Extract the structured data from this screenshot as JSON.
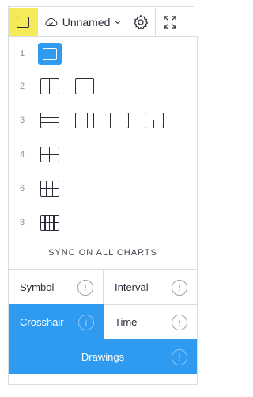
{
  "toolbar": {
    "layout_icon": "single-pane-layout-icon",
    "layout_accent": "#f5ea5a",
    "cloud_icon": "cloud-check-icon",
    "layout_name": "Unnamed",
    "chevron_icon": "chevron-down-icon",
    "settings_icon": "gear-icon",
    "fullscreen_icon": "fullscreen-icon"
  },
  "layouts": {
    "rows": [
      {
        "count": "1",
        "options": [
          "single"
        ]
      },
      {
        "count": "2",
        "options": [
          "two-vertical",
          "two-horizontal"
        ]
      },
      {
        "count": "3",
        "options": [
          "three-horizontal",
          "three-vertical",
          "one-left-two-right",
          "one-top-two-bottom"
        ]
      },
      {
        "count": "4",
        "options": [
          "four-grid"
        ]
      },
      {
        "count": "6",
        "options": [
          "six-grid"
        ]
      },
      {
        "count": "8",
        "options": [
          "eight-grid"
        ]
      }
    ],
    "selected": "single",
    "selected_color": "#2e9bf0"
  },
  "sync": {
    "heading": "SYNC ON ALL CHARTS",
    "options": [
      {
        "label": "Symbol",
        "active": false,
        "info_icon": "info-icon"
      },
      {
        "label": "Interval",
        "active": false,
        "info_icon": "info-icon"
      },
      {
        "label": "Crosshair",
        "active": true,
        "info_icon": "info-icon"
      },
      {
        "label": "Time",
        "active": false,
        "info_icon": "info-icon"
      },
      {
        "label": "Drawings",
        "active": true,
        "info_icon": "info-icon"
      }
    ],
    "info_glyph": "i",
    "active_color": "#2e9bf0"
  }
}
